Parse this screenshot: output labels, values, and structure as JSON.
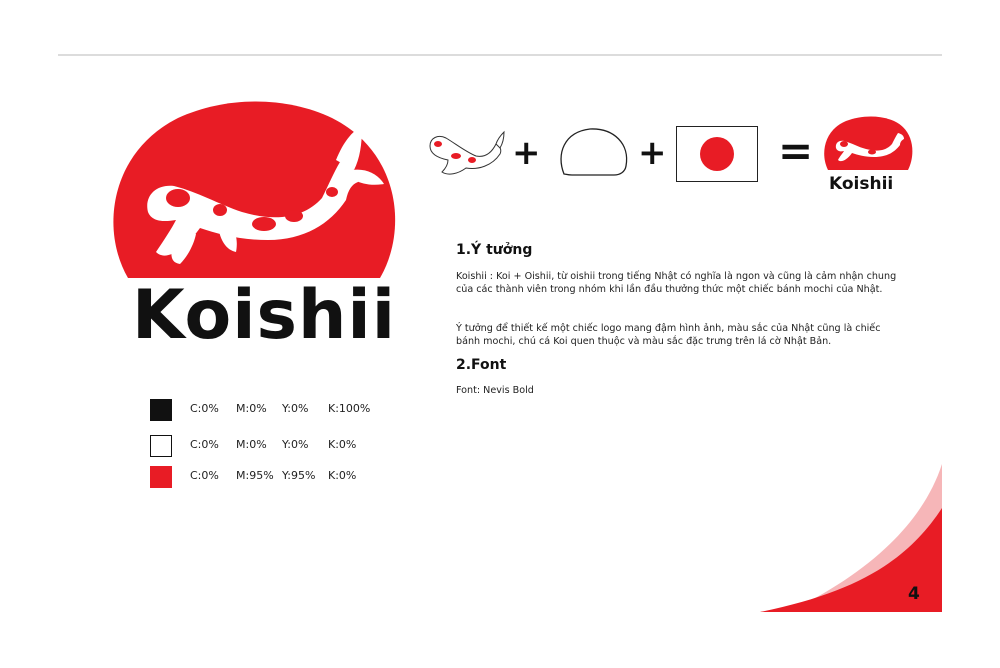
{
  "brand": {
    "name": "Koishii",
    "colors": {
      "red": "#e81c25",
      "black": "#111111",
      "white": "#ffffff",
      "pink": "#f6b6b8"
    }
  },
  "main_logo": {
    "icon": "koi-fish-mochi-logo-icon",
    "wordmark": "Koishii"
  },
  "equation": {
    "parts": [
      {
        "icon": "koi-fish-icon"
      },
      {
        "operator": "+"
      },
      {
        "icon": "mochi-outline-icon"
      },
      {
        "operator": "+"
      },
      {
        "icon": "japan-flag-icon"
      },
      {
        "operator": "="
      },
      {
        "icon": "koishii-logo-icon",
        "wordmark": "Koishii"
      }
    ]
  },
  "color_palette": [
    {
      "swatch": "#111111",
      "c": "C:0%",
      "m": "M:0%",
      "y": "Y:0%",
      "k": "K:100%"
    },
    {
      "swatch": "#ffffff",
      "c": "C:0%",
      "m": "M:0%",
      "y": "Y:0%",
      "k": "K:0%"
    },
    {
      "swatch": "#e81c25",
      "c": "C:0%",
      "m": "M:95%",
      "y": "Y:95%",
      "k": "K:0%"
    }
  ],
  "sections": [
    {
      "heading": "1.Ý tưởng",
      "paragraphs": [
        "Koishii : Koi + Oishii, từ oishii trong tiếng Nhật có nghĩa là ngon và cũng là cảm nhận chung của các thành viên trong nhóm khi lần đầu thưởng thức một chiếc bánh mochi của Nhật.",
        "Ý tưởng để thiết kế một chiếc logo mang đậm hình ảnh, màu sắc của Nhật cũng là chiếc bánh mochi, chú cá Koi quen thuộc và màu sắc đặc trưng trên lá cờ Nhật Bản."
      ]
    },
    {
      "heading": "2.Font",
      "paragraphs": [
        "Font: Nevis Bold"
      ]
    }
  ],
  "page_number": "4"
}
